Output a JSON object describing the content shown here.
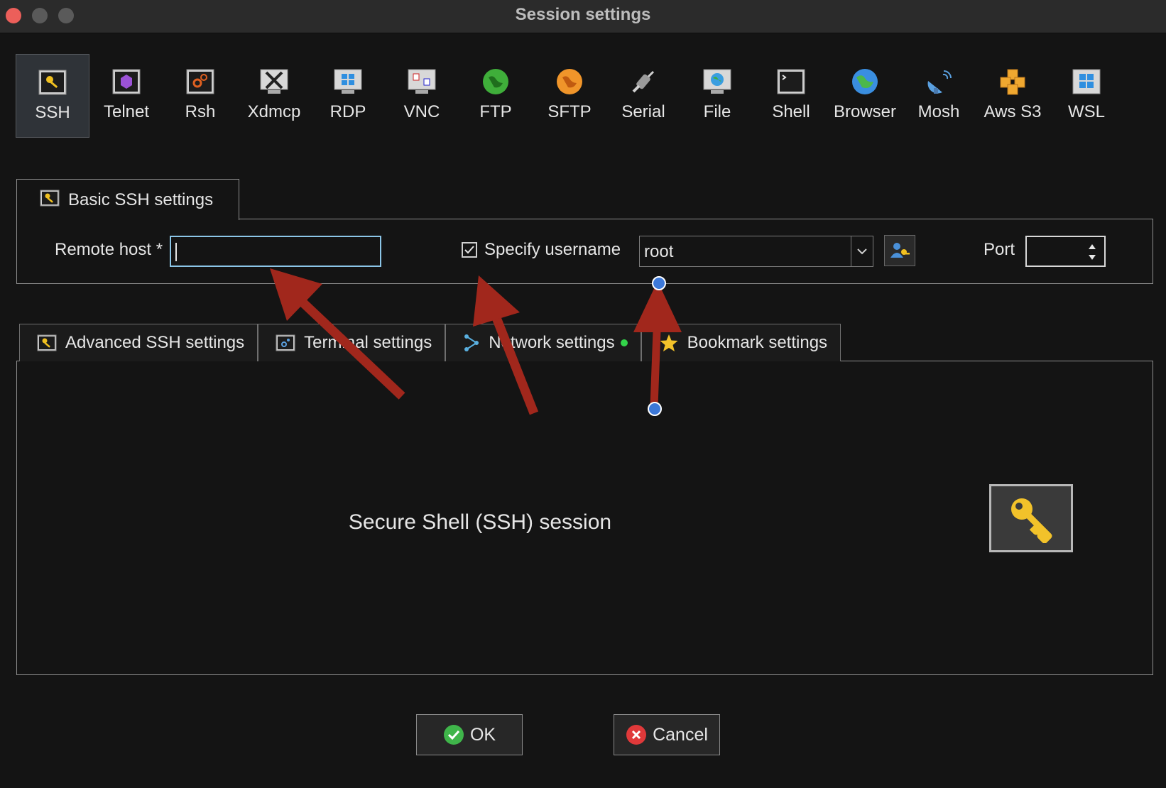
{
  "window": {
    "title": "Session settings"
  },
  "session_types": [
    {
      "label": "SSH",
      "icon": "ssh-key-icon",
      "selected": true
    },
    {
      "label": "Telnet",
      "icon": "telnet-icon",
      "selected": false
    },
    {
      "label": "Rsh",
      "icon": "rsh-icon",
      "selected": false
    },
    {
      "label": "Xdmcp",
      "icon": "xdmcp-icon",
      "selected": false
    },
    {
      "label": "RDP",
      "icon": "rdp-icon",
      "selected": false
    },
    {
      "label": "VNC",
      "icon": "vnc-icon",
      "selected": false
    },
    {
      "label": "FTP",
      "icon": "ftp-globe-icon",
      "selected": false
    },
    {
      "label": "SFTP",
      "icon": "sftp-globe-icon",
      "selected": false
    },
    {
      "label": "Serial",
      "icon": "serial-plug-icon",
      "selected": false
    },
    {
      "label": "File",
      "icon": "file-monitor-icon",
      "selected": false
    },
    {
      "label": "Shell",
      "icon": "shell-terminal-icon",
      "selected": false
    },
    {
      "label": "Browser",
      "icon": "browser-globe-icon",
      "selected": false
    },
    {
      "label": "Mosh",
      "icon": "mosh-satellite-icon",
      "selected": false
    },
    {
      "label": "Aws S3",
      "icon": "aws-s3-cubes-icon",
      "selected": false
    },
    {
      "label": "WSL",
      "icon": "wsl-windows-icon",
      "selected": false
    }
  ],
  "basic": {
    "tab_label": "Basic SSH settings",
    "remote_host_label": "Remote host *",
    "remote_host_value": "",
    "specify_username_label": "Specify username",
    "specify_username_checked": true,
    "username_value": "root",
    "port_label": "Port",
    "port_value": ""
  },
  "lower_tabs": [
    {
      "label": "Advanced SSH settings",
      "icon": "wrench-key-icon"
    },
    {
      "label": "Terminal settings",
      "icon": "terminal-settings-icon"
    },
    {
      "label": "Network settings",
      "icon": "network-icon",
      "status": "green"
    },
    {
      "label": "Bookmark settings",
      "icon": "star-icon"
    }
  ],
  "panel": {
    "description": "Secure Shell (SSH) session",
    "icon": "key-icon"
  },
  "buttons": {
    "ok_label": "OK",
    "cancel_label": "Cancel"
  },
  "colors": {
    "background": "#141414",
    "annotation_arrow": "#a1271c",
    "annotation_handle": "#3c78d8",
    "status_green": "#33d44a"
  }
}
